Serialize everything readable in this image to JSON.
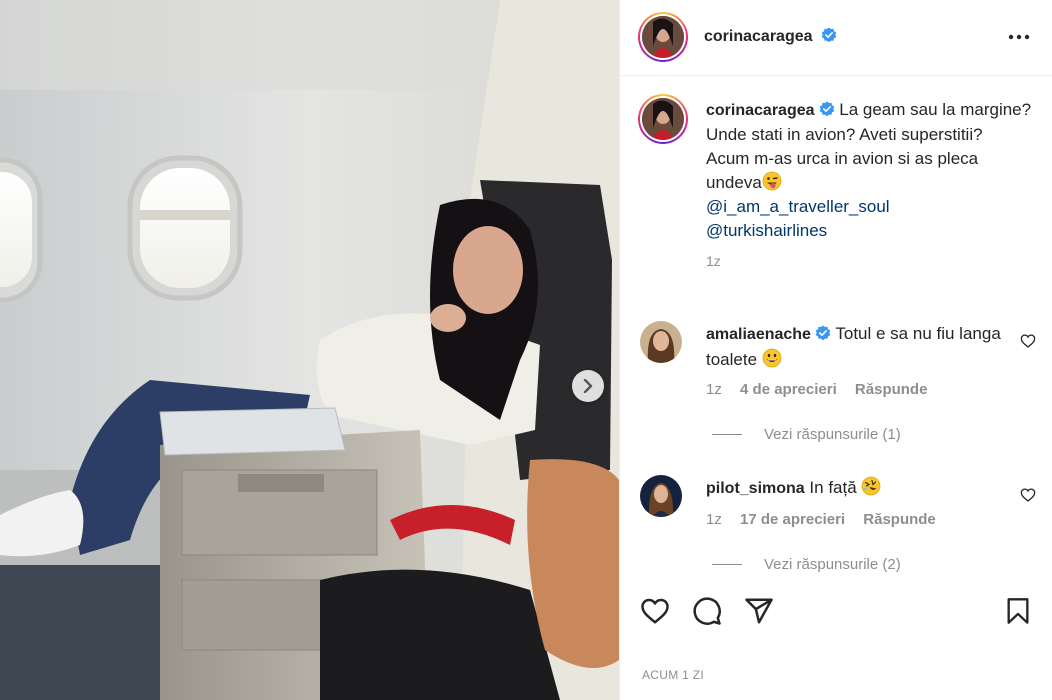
{
  "post": {
    "author": "corinacaragea",
    "caption_lines": [
      "La geam sau la margine? Unde stati in avion? Aveti superstitii?",
      "Acum m-as urca in avion si as pleca undeva"
    ],
    "mentions": [
      "@i_am_a_traveller_soul",
      "@turkishairlines"
    ],
    "caption_time": "1z",
    "posted": "ACUM 1 ZI"
  },
  "comments": [
    {
      "user": "amaliaenache",
      "verified": true,
      "text": "Totul e sa nu fiu langa toalete",
      "emoji": "grinning-face",
      "time": "1z",
      "likes": "4 de aprecieri",
      "reply": "Răspunde",
      "view_replies": "Vezi răspunsurile (1)"
    },
    {
      "user": "pilot_simona",
      "verified": false,
      "text": "In față",
      "emoji": "rofl-face",
      "time": "1z",
      "likes": "17 de aprecieri",
      "reply": "Răspunde",
      "view_replies": "Vezi răspunsurile (2)"
    }
  ],
  "icons": {
    "more": "more-horizontal-icon",
    "verified": "verified-badge-icon",
    "like": "heart-icon",
    "comment": "comment-bubble-icon",
    "share": "paper-plane-icon",
    "save": "bookmark-icon",
    "next": "chevron-right-icon"
  },
  "colors": {
    "verified": "#3897f0",
    "mention": "#00376b",
    "muted": "#8e8e8e",
    "text": "#262626"
  }
}
